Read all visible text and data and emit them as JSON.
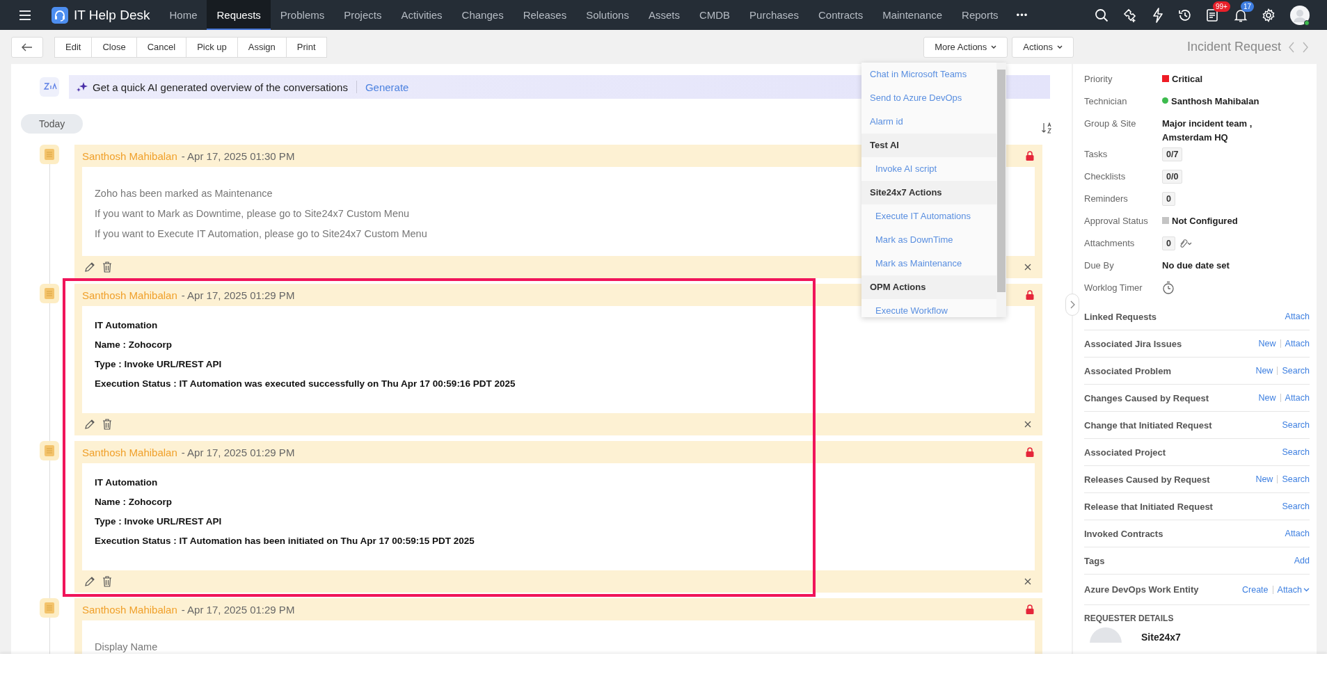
{
  "nav": {
    "app_title": "IT Help Desk",
    "items": [
      {
        "label": "Home",
        "selected": false
      },
      {
        "label": "Requests",
        "selected": true
      },
      {
        "label": "Problems",
        "selected": false
      },
      {
        "label": "Projects",
        "selected": false
      },
      {
        "label": "Activities",
        "selected": false
      },
      {
        "label": "Changes",
        "selected": false
      },
      {
        "label": "Releases",
        "selected": false
      },
      {
        "label": "Solutions",
        "selected": false
      },
      {
        "label": "Assets",
        "selected": false
      },
      {
        "label": "CMDB",
        "selected": false
      },
      {
        "label": "Purchases",
        "selected": false
      },
      {
        "label": "Contracts",
        "selected": false
      },
      {
        "label": "Maintenance",
        "selected": false
      },
      {
        "label": "Reports",
        "selected": false
      }
    ],
    "more": "•••",
    "tasks_badge": "99+",
    "notifications_badge": "17"
  },
  "toolbar": {
    "buttons": [
      "Edit",
      "Close",
      "Cancel",
      "Pick up",
      "Assign",
      "Print"
    ],
    "more_actions": "More Actions",
    "actions": "Actions",
    "title": "Incident Request"
  },
  "ai_banner": {
    "text": "Get a quick AI generated overview of the conversations",
    "link": "Generate"
  },
  "day_label": "Today",
  "notes": [
    {
      "author": "Santhosh Mahibalan",
      "date": "- Apr 17, 2025 01:30 PM",
      "bold": false,
      "lines": [
        "Zoho has been marked as Maintenance",
        "If you want to Mark as Downtime, please go to Site24x7 Custom Menu",
        "If you want to Execute IT Automation, please go to Site24x7 Custom Menu"
      ]
    },
    {
      "author": "Santhosh Mahibalan",
      "date": "- Apr 17, 2025 01:29 PM",
      "bold": true,
      "lines": [
        "IT Automation",
        "Name : Zohocorp",
        "Type : Invoke URL/REST API",
        "Execution Status : IT Automation was executed successfully on Thu Apr 17 00:59:16 PDT 2025"
      ]
    },
    {
      "author": "Santhosh Mahibalan",
      "date": "- Apr 17, 2025 01:29 PM",
      "bold": true,
      "lines": [
        "IT Automation",
        "Name : Zohocorp",
        "Type : Invoke URL/REST API",
        "Execution Status : IT Automation has been initiated on Thu Apr 17 00:59:15 PDT 2025"
      ]
    },
    {
      "author": "Santhosh Mahibalan",
      "date": "- Apr 17, 2025 01:29 PM",
      "bold": false,
      "lines": [
        "Display Name"
      ]
    }
  ],
  "menu": [
    {
      "label": "Chat in Microsoft Teams",
      "kind": "link"
    },
    {
      "label": "Send to Azure DevOps",
      "kind": "link"
    },
    {
      "label": "Alarm id",
      "kind": "link"
    },
    {
      "label": "Test AI",
      "kind": "group"
    },
    {
      "label": "Invoke AI script",
      "kind": "sub"
    },
    {
      "label": "Site24x7 Actions",
      "kind": "group"
    },
    {
      "label": "Execute IT Automations",
      "kind": "sub"
    },
    {
      "label": "Mark as DownTime",
      "kind": "sub"
    },
    {
      "label": "Mark as Maintenance",
      "kind": "sub"
    },
    {
      "label": "OPM Actions",
      "kind": "group"
    },
    {
      "label": "Execute Workflow",
      "kind": "sub"
    }
  ],
  "properties": [
    {
      "label": "Priority",
      "value": "Critical",
      "kind": "square",
      "color": "#ee1c25"
    },
    {
      "label": "Technician",
      "value": "Santhosh Mahibalan",
      "kind": "dot",
      "color": "#3dbb4e"
    },
    {
      "label": "Group & Site",
      "value": "Major incident team , Amsterdam HQ",
      "kind": "text"
    },
    {
      "label": "Tasks",
      "value": "0/7",
      "kind": "count"
    },
    {
      "label": "Checklists",
      "value": "0/0",
      "kind": "count"
    },
    {
      "label": "Reminders",
      "value": "0",
      "kind": "count"
    },
    {
      "label": "Approval Status",
      "value": "Not Configured",
      "kind": "square",
      "color": "#c4c4c4"
    },
    {
      "label": "Attachments",
      "value": "0",
      "kind": "attach"
    },
    {
      "label": "Due By",
      "value": "No due date set",
      "kind": "text"
    },
    {
      "label": "Worklog Timer",
      "kind": "timer"
    }
  ],
  "sections": [
    {
      "label": "Linked Requests",
      "actions": [
        "Attach"
      ],
      "dropdown": false
    },
    {
      "label": "Associated Jira Issues",
      "actions": [
        "New",
        "Attach"
      ],
      "dropdown": false
    },
    {
      "label": "Associated Problem",
      "actions": [
        "New",
        "Search"
      ],
      "dropdown": false
    },
    {
      "label": "Changes Caused by Request",
      "actions": [
        "New",
        "Attach"
      ],
      "dropdown": false
    },
    {
      "label": "Change that Initiated Request",
      "actions": [
        "Search"
      ],
      "dropdown": false
    },
    {
      "label": "Associated Project",
      "actions": [
        "Search"
      ],
      "dropdown": false
    },
    {
      "label": "Releases Caused by Request",
      "actions": [
        "New",
        "Search"
      ],
      "dropdown": false
    },
    {
      "label": "Release that Initiated Request",
      "actions": [
        "Search"
      ],
      "dropdown": false
    },
    {
      "label": "Invoked Contracts",
      "actions": [
        "Attach"
      ],
      "dropdown": false
    },
    {
      "label": "Tags",
      "actions": [
        "Add"
      ],
      "dropdown": false
    },
    {
      "label": "Azure DevOps Work Entity",
      "actions": [
        "Create",
        "Attach"
      ],
      "dropdown": true
    }
  ],
  "requester": {
    "heading": "REQUESTER DETAILS",
    "name": "Site24x7"
  }
}
